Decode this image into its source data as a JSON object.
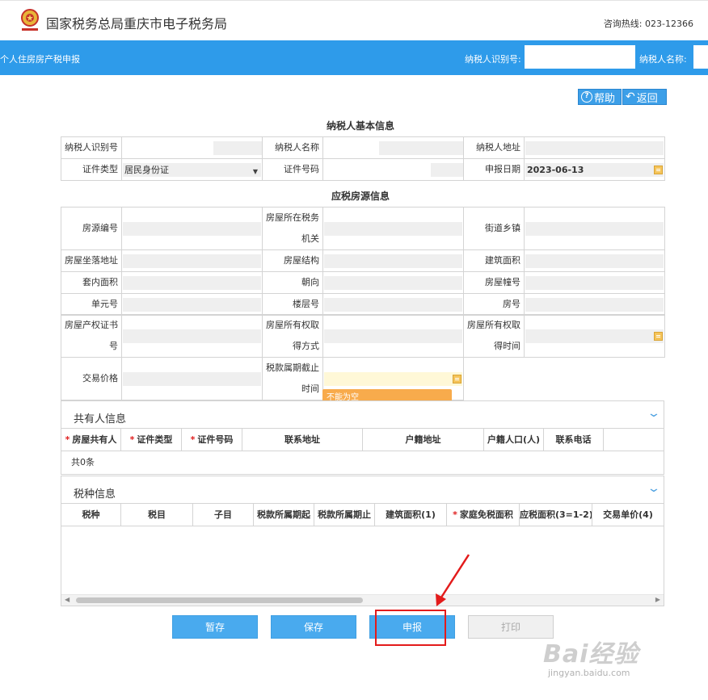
{
  "header": {
    "title": "国家税务总局重庆市电子税务局",
    "hotline_label": "咨询热线:",
    "hotline_number": "023-12366"
  },
  "bluebar": {
    "page_name": "个人住房房产税申报",
    "taxpayer_id_label": "纳税人识别号:",
    "taxpayer_name_label": "纳税人名称:"
  },
  "toolbar": {
    "help_label": "帮助",
    "back_label": "返回"
  },
  "basic_info": {
    "title": "纳税人基本信息",
    "taxpayer_id_label": "纳税人识别号",
    "taxpayer_name_label": "纳税人名称",
    "taxpayer_name_value": "",
    "taxpayer_address_label": "纳税人地址",
    "id_type_label": "证件类型",
    "id_type_value": "居民身份证",
    "id_number_label": "证件号码",
    "id_number_value": "",
    "declare_date_label": "申报日期",
    "declare_date_value": "2023-06-13"
  },
  "property_info": {
    "title": "应税房源信息",
    "source_no_label": "房源编号",
    "tax_office_label_1": "房屋所在税务",
    "tax_office_label_2": "机关",
    "street_label": "街道乡镇",
    "location_label": "房屋坐落地址",
    "structure_label": "房屋结构",
    "building_area_label": "建筑面积",
    "inner_area_label": "套内面积",
    "orientation_label": "朝向",
    "building_no_label": "房屋幢号",
    "unit_no_label": "单元号",
    "floor_no_label": "楼层号",
    "room_no_label": "房号",
    "cert_no_label_1": "房屋产权证书",
    "cert_no_label_2": "号",
    "acquire_way_label_1": "房屋所有权取",
    "acquire_way_label_2": "得方式",
    "acquire_time_label_1": "房屋所有权取",
    "acquire_time_label_2": "得时间",
    "trade_price_label": "交易价格",
    "period_end_label_1": "税款属期截止",
    "period_end_label_2": "时间",
    "period_end_tip": "不能为空"
  },
  "co_owner_panel": {
    "title": "共有人信息",
    "columns": [
      "房屋共有人",
      "证件类型",
      "证件号码",
      "联系地址",
      "户籍地址",
      "户籍人口(人)",
      "联系电话"
    ],
    "count_text": "共0条"
  },
  "tax_panel": {
    "title": "税种信息",
    "columns": [
      "税种",
      "税目",
      "子目",
      "税款所属期起",
      "税款所属期止",
      "建筑面积(1)",
      "家庭免税面积",
      "应税面积(3=1-2)",
      "交易单价(4)"
    ]
  },
  "actions": {
    "save_draft": "暂存",
    "save": "保存",
    "declare": "申报",
    "print": "打印"
  },
  "watermark": {
    "brand": "Bai经验",
    "url": "jingyan.baidu.com"
  },
  "colors": {
    "accent_blue": "#2e9bea",
    "button_blue": "#49aaee",
    "tip_orange": "#f8ab4c",
    "highlight_red": "#e31b1b",
    "required_red": "#e02020"
  }
}
